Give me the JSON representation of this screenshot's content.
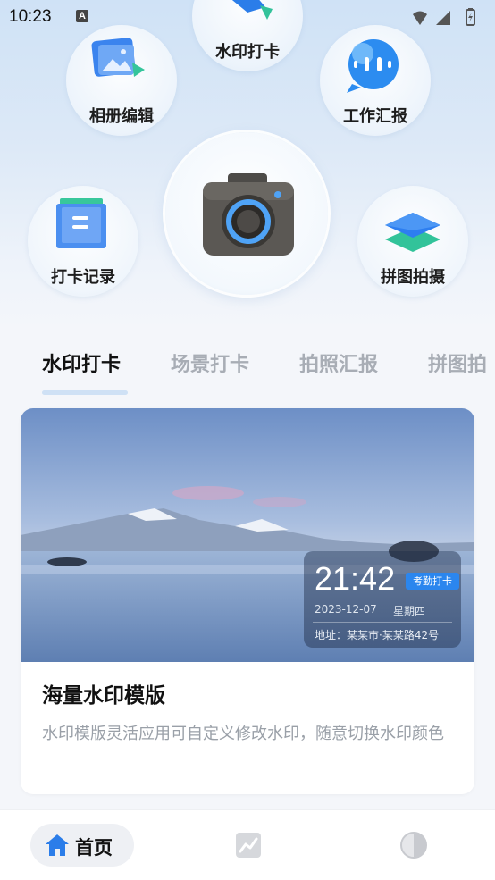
{
  "status_bar": {
    "time": "10:23",
    "notification_letter": "A"
  },
  "shortcuts": {
    "watermark_checkin": "水印打卡",
    "album_edit": "相册编辑",
    "work_report": "工作汇报",
    "checkin_record": "打卡记录",
    "collage_shoot": "拼图拍摄"
  },
  "tabs": [
    "水印打卡",
    "场景打卡",
    "拍照汇报",
    "拼图拍"
  ],
  "card": {
    "title": "海量水印模版",
    "description": "水印模版灵活应用可自定义修改水印，随意切换水印颜色",
    "watermark": {
      "time": "21:42",
      "badge": "考勤打卡",
      "date": "2023-12-07",
      "weekday": "星期四",
      "address": "地址：某某市·某某路42号"
    }
  },
  "bottom_nav": {
    "home_label": "首页"
  },
  "icons": [
    "camera-icon",
    "album-icon",
    "chat-icon",
    "document-icon",
    "layers-icon",
    "home-icon",
    "chart-icon",
    "contrast-icon"
  ],
  "colors": {
    "accent": "#2b86ee",
    "tab_active": "#111111",
    "tab_inactive": "#a8adb5"
  }
}
